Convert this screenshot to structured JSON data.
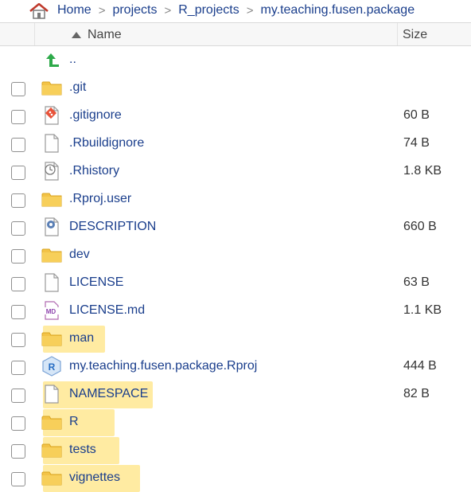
{
  "breadcrumb": {
    "home_icon": "home-icon",
    "items": [
      "Home",
      "projects",
      "R_projects",
      "my.teaching.fusen.package"
    ],
    "separator": ">"
  },
  "table": {
    "columns": {
      "name": "Name",
      "size": "Size",
      "sort": "ascending-by-name"
    },
    "parent_link": "..",
    "rows": [
      {
        "name": ".git",
        "size": "",
        "icon": "folder-icon",
        "highlighted": false
      },
      {
        "name": ".gitignore",
        "size": "60 B",
        "icon": "git-file-icon",
        "highlighted": false
      },
      {
        "name": ".Rbuildignore",
        "size": "74 B",
        "icon": "file-icon",
        "highlighted": false
      },
      {
        "name": ".Rhistory",
        "size": "1.8 KB",
        "icon": "history-file-icon",
        "highlighted": false
      },
      {
        "name": ".Rproj.user",
        "size": "",
        "icon": "folder-icon",
        "highlighted": false
      },
      {
        "name": "DESCRIPTION",
        "size": "660 B",
        "icon": "description-file-icon",
        "highlighted": false
      },
      {
        "name": "dev",
        "size": "",
        "icon": "folder-icon",
        "highlighted": false
      },
      {
        "name": "LICENSE",
        "size": "63 B",
        "icon": "file-icon",
        "highlighted": false
      },
      {
        "name": "LICENSE.md",
        "size": "1.1 KB",
        "icon": "markdown-file-icon",
        "highlighted": false
      },
      {
        "name": "man",
        "size": "",
        "icon": "folder-icon",
        "highlighted": true
      },
      {
        "name": "my.teaching.fusen.package.Rproj",
        "size": "444 B",
        "icon": "rproj-file-icon",
        "highlighted": false
      },
      {
        "name": "NAMESPACE",
        "size": "82 B",
        "icon": "file-icon",
        "highlighted": true
      },
      {
        "name": "R",
        "size": "",
        "icon": "folder-icon",
        "highlighted": true
      },
      {
        "name": "tests",
        "size": "",
        "icon": "folder-icon",
        "highlighted": true
      },
      {
        "name": "vignettes",
        "size": "",
        "icon": "folder-icon",
        "highlighted": true
      }
    ]
  },
  "colors": {
    "link": "#1a3e8c",
    "highlight": "#ffe27a",
    "folder": "#f3c347",
    "up_arrow": "#2eaa4a"
  }
}
